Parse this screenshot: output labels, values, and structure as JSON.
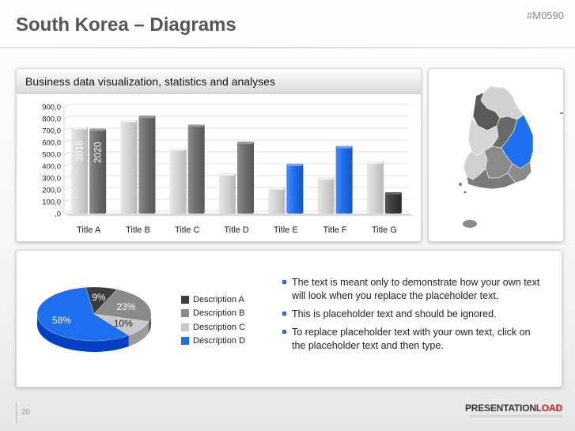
{
  "page": {
    "title": "South Korea – Diagrams",
    "code": "#M0590",
    "page_number": "20",
    "brand_part1": "PRESENTATION",
    "brand_part2": "LOAD"
  },
  "chart_panel": {
    "header": "Business data visualization, statistics and analyses"
  },
  "colors": {
    "light_gray": "#cfcfcf",
    "dark_gray": "#6f6f6f",
    "blue": "#1e6ef0",
    "darkest": "#3c3c3c",
    "mid_gray": "#8a8a8a"
  },
  "chart_data": [
    {
      "type": "bar",
      "title": "Business data visualization, statistics and analyses",
      "categories": [
        "Title A",
        "Title B",
        "Title C",
        "Title D",
        "Title E",
        "Title F",
        "Title G"
      ],
      "y_tick_labels": [
        ",0",
        "100,0",
        "200,0",
        "300,0",
        "400,0",
        "500,0",
        "600,0",
        "700,0",
        "800,0",
        "900,0"
      ],
      "ylim": [
        0,
        900
      ],
      "grid": true,
      "series": [
        {
          "name": "2015",
          "values": [
            730,
            790,
            550,
            340,
            220,
            305,
            440
          ],
          "colors": [
            "light",
            "light",
            "light",
            "light",
            "light",
            "light",
            "light"
          ]
        },
        {
          "name": "2020",
          "values": [
            715,
            825,
            750,
            605,
            420,
            570,
            180
          ],
          "colors": [
            "dark",
            "dark",
            "dark",
            "dark",
            "blue",
            "blue",
            "darkest"
          ]
        }
      ]
    },
    {
      "type": "pie",
      "slices": [
        {
          "label": "Description A",
          "value": 9,
          "text": "9%",
          "color": "#3c3c3c"
        },
        {
          "label": "Description B",
          "value": 23,
          "text": "23%",
          "color": "#8a8a8a"
        },
        {
          "label": "Description C",
          "value": 10,
          "text": "10%",
          "color": "#c9c9c9"
        },
        {
          "label": "Description D",
          "value": 58,
          "text": "58%",
          "color": "#1e6ef0"
        }
      ]
    }
  ],
  "bullets": [
    "The text is meant only to demonstrate how your own text will look when you replace the placeholder text.",
    "This is placeholder text and should be ignored.",
    "To replace placeholder text with your own text, click on the placeholder text and then type."
  ]
}
